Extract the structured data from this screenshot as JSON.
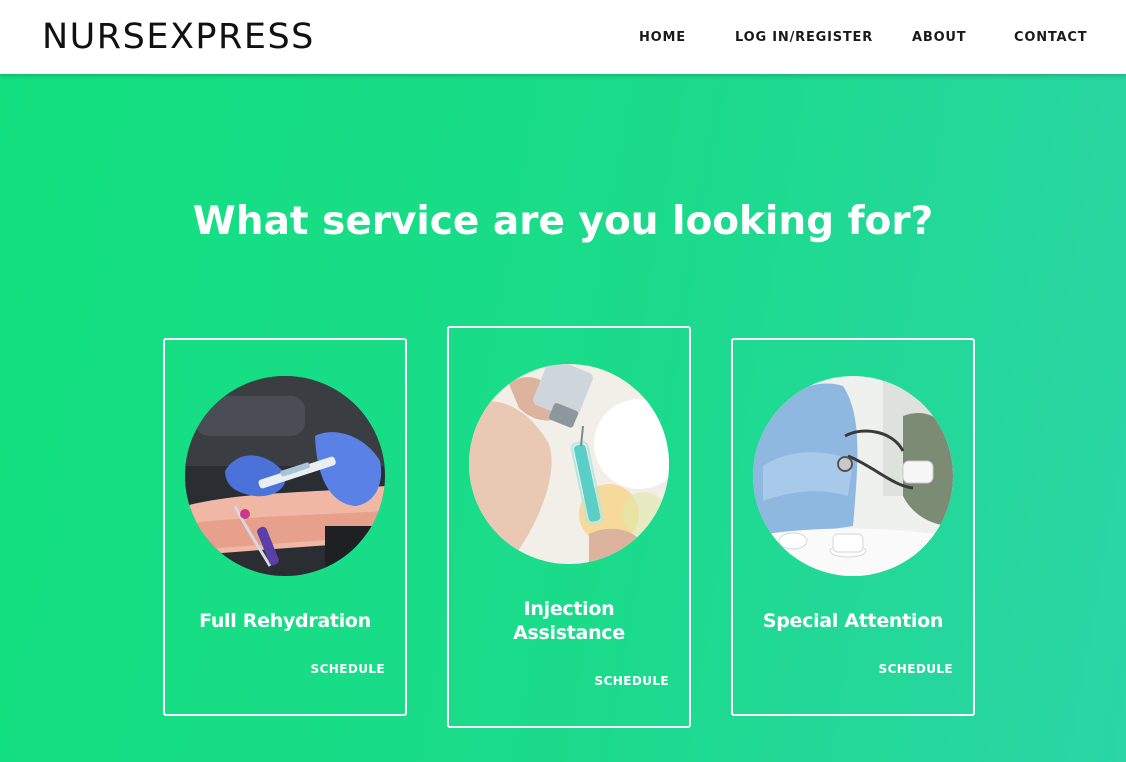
{
  "header": {
    "logo": "NURSEXPRESS",
    "nav": {
      "home": "HOME",
      "login": "LOG IN/REGISTER",
      "about": "ABOUT",
      "contact": "CONTACT"
    }
  },
  "hero": {
    "title": "What service are you looking for?"
  },
  "services": [
    {
      "title": "Full Rehydration",
      "link": "SCHEDULE",
      "image": "iv-drip-photo"
    },
    {
      "title": "Injection Assistance",
      "link": "SCHEDULE",
      "image": "syringe-vial-photo"
    },
    {
      "title": "Special Attention",
      "link": "SCHEDULE",
      "image": "blood-pressure-photo"
    }
  ],
  "colors": {
    "background_start": "#13e07f",
    "background_end": "#2bd5a6",
    "header_bg": "#ffffff",
    "text_light": "#ffffff",
    "text_dark": "#111111"
  }
}
